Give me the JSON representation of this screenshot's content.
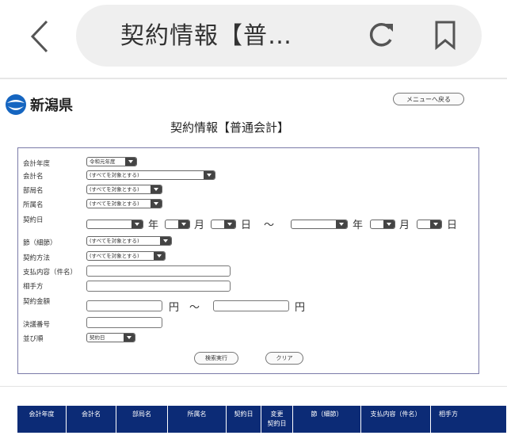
{
  "browser": {
    "title": "契約情報【普…"
  },
  "header": {
    "logo_text": "新潟県",
    "menu_back_label": "メニューへ戻る",
    "page_title": "契約情報【普通会計】"
  },
  "form": {
    "labels": {
      "fiscal_year": "会計年度",
      "account_name": "会計名",
      "department": "部局名",
      "section": "所属名",
      "contract_date": "契約日",
      "budget_item": "節（細節）",
      "contract_method": "契約方法",
      "payment_detail": "支払内容（件名）",
      "counterparty": "相手方",
      "contract_amount": "契約金額",
      "resolution_no": "決議番号",
      "sort_order": "並び順"
    },
    "values": {
      "fiscal_year": "令和元年度",
      "account_name": "(すべてを対象とする)",
      "department": "(すべてを対象とする)",
      "section": "(すべてを対象とする)",
      "budget_item": "(すべてを対象とする)",
      "contract_method": "(すべてを対象とする)",
      "sort_order": "契約日"
    },
    "units": {
      "year": "年",
      "month": "月",
      "day": "日",
      "tilde": "～",
      "yen": "円"
    },
    "search_label": "検索実行",
    "clear_label": "クリア"
  },
  "table": {
    "headers": [
      "会計年度",
      "会計名",
      "部局名",
      "所属名",
      "契約日",
      "変更\n契約日",
      "節（細節）",
      "支払内容（件名）",
      "相手方"
    ]
  },
  "colors": {
    "table_header_bg": "#0c2b76",
    "logo_blue": "#1565c0"
  }
}
